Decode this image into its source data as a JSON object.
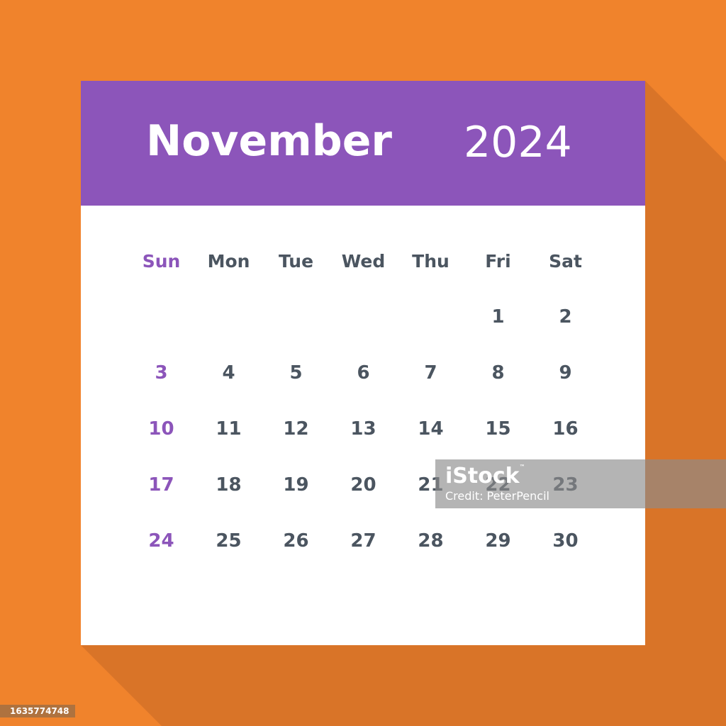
{
  "calendar": {
    "month": "November",
    "year": "2024",
    "weekdays": [
      "Sun",
      "Mon",
      "Tue",
      "Wed",
      "Thu",
      "Fri",
      "Sat"
    ],
    "weeks": [
      [
        "",
        "",
        "",
        "",
        "",
        "1",
        "2"
      ],
      [
        "3",
        "4",
        "5",
        "6",
        "7",
        "8",
        "9"
      ],
      [
        "10",
        "11",
        "12",
        "13",
        "14",
        "15",
        "16"
      ],
      [
        "17",
        "18",
        "19",
        "20",
        "21",
        "22",
        "23"
      ],
      [
        "24",
        "25",
        "26",
        "27",
        "28",
        "29",
        "30"
      ]
    ]
  },
  "colors": {
    "background": "#F0832C",
    "shadow": "#D97428",
    "header": "#8C55BA",
    "sunday": "#8C55BA",
    "text": "#4B5560"
  },
  "watermark": {
    "logo": "iStock",
    "tm": "™",
    "credit": "Credit: PeterPencil"
  },
  "image_id": "1635774748"
}
